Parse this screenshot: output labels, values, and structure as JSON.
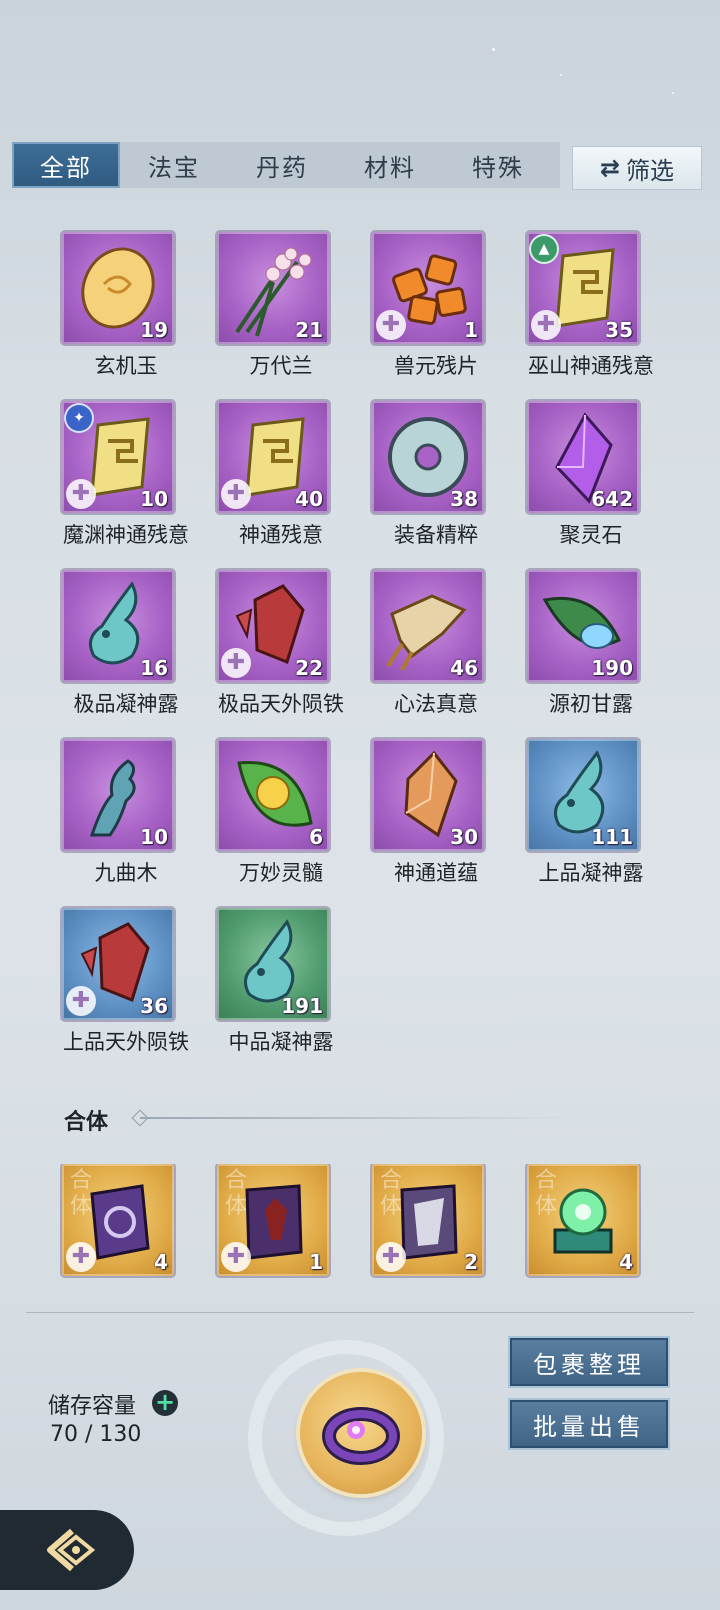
{
  "tabs": [
    "全部",
    "法宝",
    "丹药",
    "材料",
    "特殊"
  ],
  "filter": {
    "label": "筛选",
    "icon": "swap-arrows-icon"
  },
  "items": [
    {
      "name": "玄机玉",
      "count": "19",
      "frame": "purple",
      "icon": "golden-jade-icon"
    },
    {
      "name": "万代兰",
      "count": "21",
      "frame": "purple",
      "icon": "orchid-flower-icon"
    },
    {
      "name": "兽元残片",
      "count": "1",
      "frame": "purple",
      "icon": "beast-fragment-icon",
      "puzzle": true
    },
    {
      "name": "巫山神通残意",
      "count": "35",
      "frame": "purple",
      "icon": "scroll-fragment-icon",
      "puzzle": true,
      "badge": "green"
    },
    {
      "name": "魔渊神通残意",
      "count": "10",
      "frame": "purple",
      "icon": "scroll-fragment-icon",
      "puzzle": true,
      "badge": "blue"
    },
    {
      "name": "神通残意",
      "count": "40",
      "frame": "purple",
      "icon": "scroll-fragment-icon",
      "puzzle": true
    },
    {
      "name": "装备精粹",
      "count": "38",
      "frame": "purple",
      "icon": "jade-disc-icon"
    },
    {
      "name": "聚灵石",
      "count": "642",
      "frame": "purple",
      "icon": "purple-crystal-icon"
    },
    {
      "name": "极品凝神露",
      "count": "16",
      "frame": "purple",
      "icon": "dew-flask-icon"
    },
    {
      "name": "极品天外陨铁",
      "count": "22",
      "frame": "purple",
      "icon": "red-meteor-icon",
      "puzzle": true
    },
    {
      "name": "心法真意",
      "count": "46",
      "frame": "purple",
      "icon": "golden-relic-icon"
    },
    {
      "name": "源初甘露",
      "count": "190",
      "frame": "purple",
      "icon": "leaf-dew-icon"
    },
    {
      "name": "九曲木",
      "count": "10",
      "frame": "purple",
      "icon": "twisted-wood-icon"
    },
    {
      "name": "万妙灵髓",
      "count": "6",
      "frame": "purple",
      "icon": "leaf-orb-icon"
    },
    {
      "name": "神通道蕴",
      "count": "30",
      "frame": "purple",
      "icon": "amber-crystal-icon"
    },
    {
      "name": "上品凝神露",
      "count": "111",
      "frame": "blue",
      "icon": "dew-flask-icon"
    },
    {
      "name": "上品天外陨铁",
      "count": "36",
      "frame": "blue",
      "icon": "red-meteor-icon",
      "puzzle": true
    },
    {
      "name": "中品凝神露",
      "count": "191",
      "frame": "green",
      "icon": "dew-flask-icon"
    }
  ],
  "section": {
    "title": "合体",
    "watermark": "合体",
    "items": [
      {
        "count": "4",
        "frame": "gold",
        "icon": "purple-talisman-icon",
        "puzzle": true
      },
      {
        "count": "1",
        "frame": "gold",
        "icon": "dark-figure-card-icon",
        "puzzle": true
      },
      {
        "count": "2",
        "frame": "gold",
        "icon": "silver-card-icon",
        "puzzle": true
      },
      {
        "count": "4",
        "frame": "gold",
        "icon": "green-orb-altar-icon"
      }
    ]
  },
  "storage": {
    "label": "储存容量",
    "value": "70 / 130"
  },
  "buttons": {
    "organize": "包裹整理",
    "bulk_sell": "批量出售"
  },
  "colors": {
    "accent_tab": "#2f5a80",
    "purple_frame": "#a862c6",
    "blue_frame": "#5d8fc3",
    "green_frame": "#4e9a6d",
    "gold_frame": "#e0aa47"
  }
}
